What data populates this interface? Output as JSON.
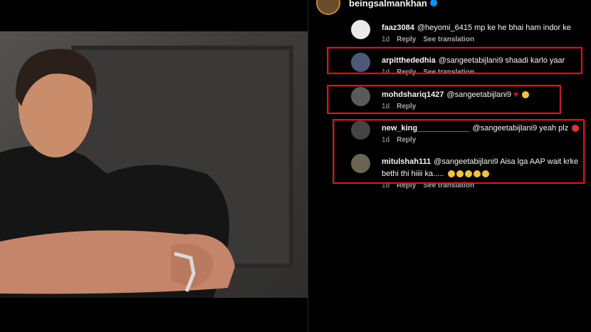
{
  "header": {
    "account": "beingsalmankhan"
  },
  "comments": [
    {
      "user": "faaz3084",
      "text": "@heyomi_6415 mp ke he bhai ham indor ke",
      "time": "1d",
      "reply": "Reply",
      "see": "See translation",
      "avatar_color": "#e9e9e9"
    },
    {
      "user": "arpitthededhia",
      "text": "@sangeetabijlani9 shaadi karlo yaar",
      "time": "1d",
      "reply": "Reply",
      "see": "See translation",
      "avatar_color": "#4a5a78"
    },
    {
      "user": "mohdshariq1427",
      "text": "@sangeetabijlani9",
      "time": "1d",
      "reply": "Reply",
      "avatar_color": "#5a5a5a"
    },
    {
      "user": "new_king____________",
      "text": "@sangeetabijlani9 yeah plz",
      "time": "1d",
      "reply": "Reply",
      "avatar_color": "#444444"
    },
    {
      "user": "mitulshah111",
      "text": "@sangeetabijlani9 Aisa lga AAP wait krke bethi thi hiiii ka.....",
      "time": "1d",
      "reply": "Reply",
      "see": "See translation",
      "avatar_color": "#6a6552"
    }
  ],
  "colors": {
    "highlight": "#e0101a",
    "background": "#000000"
  }
}
